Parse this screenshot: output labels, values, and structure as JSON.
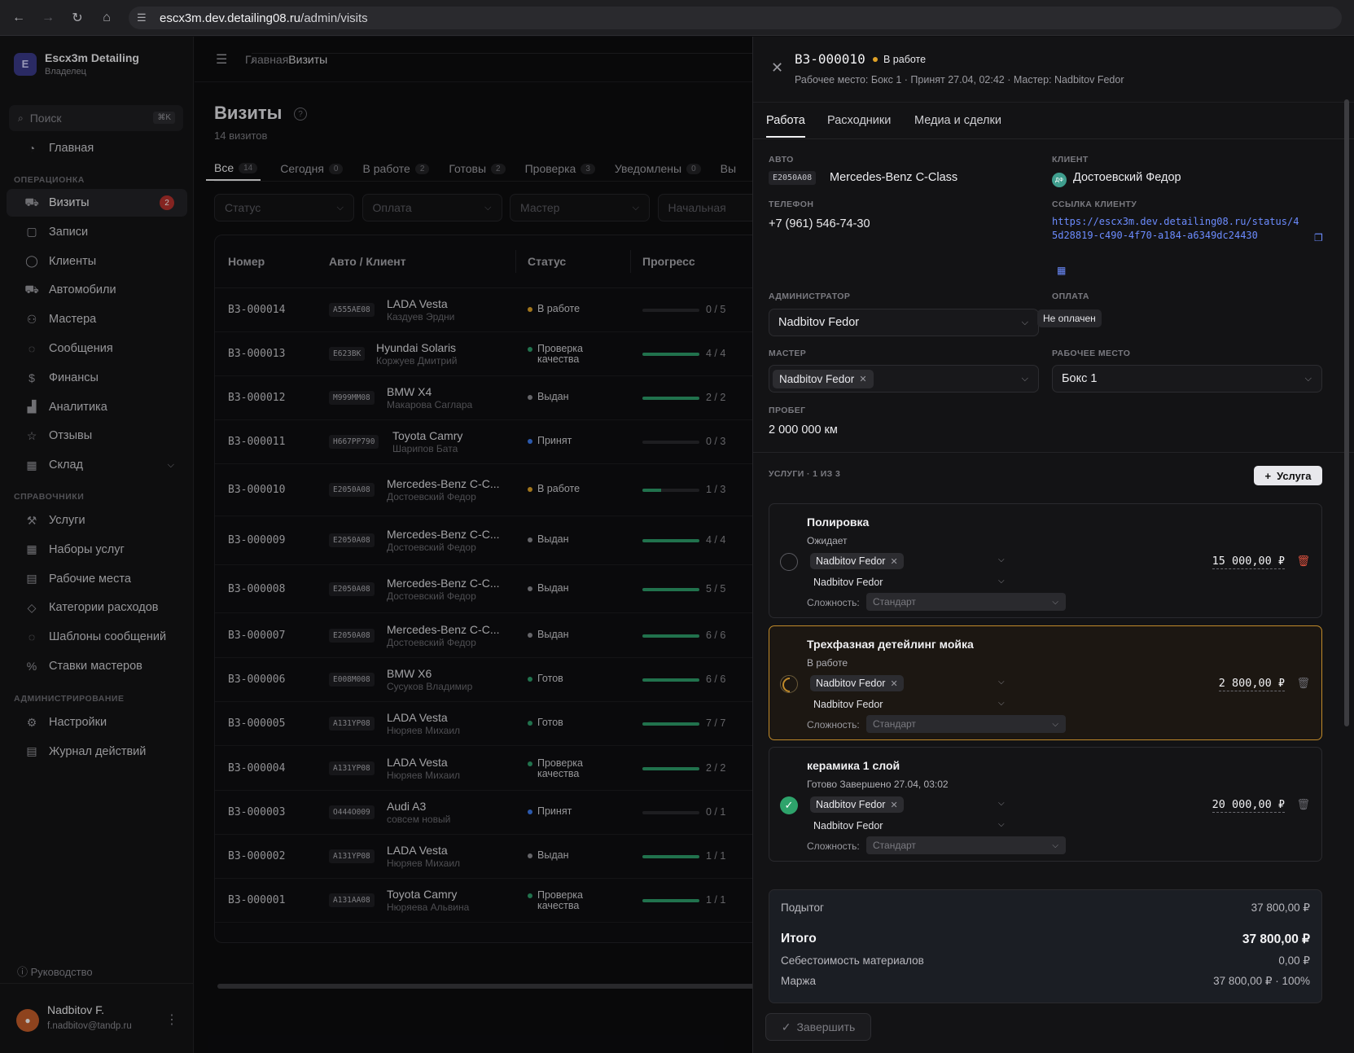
{
  "browser": {
    "url_host": "escx3m.dev.detailing08.ru",
    "url_path": "/admin/visits"
  },
  "sidebar": {
    "brand_initial": "E",
    "brand_name": "Escx3m Detailing",
    "brand_role": "Владелец",
    "search_placeholder": "Поиск",
    "search_shortcut": "⌘K",
    "home": "Главная",
    "sections": {
      "operations": "ОПЕРАЦИОНКА",
      "references": "СПРАВОЧНИКИ",
      "admin": "АДМИНИСТРИРОВАНИЕ"
    },
    "operations_items": [
      {
        "label": "Визиты",
        "icon": "car-icon",
        "badge": "2"
      },
      {
        "label": "Записи",
        "icon": "calendar-icon"
      },
      {
        "label": "Клиенты",
        "icon": "user-icon"
      },
      {
        "label": "Автомобили",
        "icon": "car-icon"
      },
      {
        "label": "Мастера",
        "icon": "users-icon"
      },
      {
        "label": "Сообщения",
        "icon": "message-icon"
      },
      {
        "label": "Финансы",
        "icon": "dollar-icon"
      },
      {
        "label": "Аналитика",
        "icon": "chart-icon"
      },
      {
        "label": "Отзывы",
        "icon": "star-icon"
      },
      {
        "label": "Склад",
        "icon": "grid-icon"
      }
    ],
    "reference_items": [
      {
        "label": "Услуги",
        "icon": "wrench-icon"
      },
      {
        "label": "Наборы услуг",
        "icon": "grid-icon"
      },
      {
        "label": "Рабочие места",
        "icon": "workplace-icon"
      },
      {
        "label": "Категории расходов",
        "icon": "tag-icon"
      },
      {
        "label": "Шаблоны сообщений",
        "icon": "message-icon"
      },
      {
        "label": "Ставки мастеров",
        "icon": "percent-icon"
      }
    ],
    "admin_items": [
      {
        "label": "Настройки",
        "icon": "gear-icon"
      },
      {
        "label": "Журнал действий",
        "icon": "log-icon"
      }
    ],
    "guide": "Руководство",
    "user_name": "Nadbitov F.",
    "user_email": "f.nadbitov@tandp.ru"
  },
  "main": {
    "breadcrumb_home": "Главная",
    "breadcrumb_current": "Визиты",
    "title": "Визиты",
    "subtitle": "14 визитов",
    "tabs": [
      {
        "label": "Все",
        "count": "14"
      },
      {
        "label": "Сегодня",
        "count": "0"
      },
      {
        "label": "В работе",
        "count": "2"
      },
      {
        "label": "Готовы",
        "count": "2"
      },
      {
        "label": "Проверка",
        "count": "3"
      },
      {
        "label": "Уведомлены",
        "count": "0"
      },
      {
        "label": "Вы",
        "count": ""
      }
    ],
    "filters": [
      "Статус",
      "Оплата",
      "Мастер",
      "Начальная"
    ],
    "columns": [
      "Номер",
      "Авто / Клиент",
      "Статус",
      "Прогресс"
    ],
    "rows": [
      {
        "num": "B3-000014",
        "plate": "A555AE08",
        "car": "LADA Vesta",
        "client": "Каздуев Эрдни",
        "status": "В работе",
        "status_color": "#e0a227",
        "progress": "0 / 5",
        "fill": 0.0
      },
      {
        "num": "B3-000013",
        "plate": "E623BK",
        "car": "Hyundai Solaris",
        "client": "Коржуев Дмитрий",
        "status": "Проверка качества",
        "status_color": "#2e9e6b",
        "progress": "4 / 4",
        "fill": 1.0
      },
      {
        "num": "B3-000012",
        "plate": "M999MM08",
        "car": "BMW X4",
        "client": "Макарова Саглара",
        "status": "Выдан",
        "status_color": "#8c8c92",
        "progress": "2 / 2",
        "fill": 1.0
      },
      {
        "num": "B3-000011",
        "plate": "H667PP790",
        "car": "Toyota Camry",
        "client": "Шарипов Бата",
        "status": "Принят",
        "status_color": "#3c7cf0",
        "progress": "0 / 3",
        "fill": 0.0
      },
      {
        "num": "B3-000010",
        "plate": "E2050A08",
        "car": "Mercedes-Benz C-C...",
        "client": "Достоевский Федор",
        "status": "В работе",
        "status_color": "#e0a227",
        "progress": "1 / 3",
        "fill": 0.33
      },
      {
        "num": "B3-000009",
        "plate": "E2050A08",
        "car": "Mercedes-Benz C-C...",
        "client": "Достоевский Федор",
        "status": "Выдан",
        "status_color": "#8c8c92",
        "progress": "4 / 4",
        "fill": 1.0
      },
      {
        "num": "B3-000008",
        "plate": "E2050A08",
        "car": "Mercedes-Benz C-C...",
        "client": "Достоевский Федор",
        "status": "Выдан",
        "status_color": "#8c8c92",
        "progress": "5 / 5",
        "fill": 1.0
      },
      {
        "num": "B3-000007",
        "plate": "E2050A08",
        "car": "Mercedes-Benz C-C...",
        "client": "Достоевский Федор",
        "status": "Выдан",
        "status_color": "#8c8c92",
        "progress": "6 / 6",
        "fill": 1.0
      },
      {
        "num": "B3-000006",
        "plate": "E008M008",
        "car": "BMW X6",
        "client": "Сусуков Владимир",
        "status": "Готов",
        "status_color": "#2e9e6b",
        "progress": "6 / 6",
        "fill": 1.0
      },
      {
        "num": "B3-000005",
        "plate": "A131YP08",
        "car": "LADA Vesta",
        "client": "Нюряев Михаил",
        "status": "Готов",
        "status_color": "#2e9e6b",
        "progress": "7 / 7",
        "fill": 1.0
      },
      {
        "num": "B3-000004",
        "plate": "A131YP08",
        "car": "LADA Vesta",
        "client": "Нюряев Михаил",
        "status": "Проверка качества",
        "status_color": "#2e9e6b",
        "progress": "2 / 2",
        "fill": 1.0
      },
      {
        "num": "B3-000003",
        "plate": "O444O009",
        "car": "Audi A3",
        "client": "совсем новый",
        "status": "Принят",
        "status_color": "#3c7cf0",
        "progress": "0 / 1",
        "fill": 0.0
      },
      {
        "num": "B3-000002",
        "plate": "A131YP08",
        "car": "LADA Vesta",
        "client": "Нюряев Михаил",
        "status": "Выдан",
        "status_color": "#8c8c92",
        "progress": "1 / 1",
        "fill": 1.0
      },
      {
        "num": "B3-000001",
        "plate": "A131AA08",
        "car": "Toyota Camry",
        "client": "Нюряева Альвина",
        "status": "Проверка качества",
        "status_color": "#2e9e6b",
        "progress": "1 / 1",
        "fill": 1.0
      }
    ]
  },
  "drawer": {
    "number": "B3-000010",
    "status": "В работе",
    "meta": "Рабочее место: Бокс 1 · Принят 27.04, 02:42 · Мастер: Nadbitov Fedor",
    "tabs": [
      "Работа",
      "Расходники",
      "Медиа и сделки"
    ],
    "labels": {
      "auto": "АВТО",
      "client": "КЛИЕНТ",
      "phone": "ТЕЛЕФОН",
      "client_link": "ССЫЛКА КЛИЕНТУ",
      "admin": "АДМИНИСТРАТОР",
      "payment": "ОПЛАТА",
      "master": "МАСТЕР",
      "workplace": "РАБОЧЕЕ МЕСТО",
      "mileage": "ПРОБЕГ",
      "services": "УСЛУГИ · 1 ИЗ 3"
    },
    "plate": "E2050A08",
    "car": "Mercedes-Benz C-Class",
    "client_initials": "ДФ",
    "client": "Достоевский Федор",
    "phone": "+7 (961) 546-74-30",
    "link": "https://escx3m.dev.detailing08.ru/status/45d28819-c490-4f70-a184-a6349dc24430",
    "admin": "Nadbitov Fedor",
    "payment": "Не оплачен",
    "master": "Nadbitov Fedor",
    "workplace": "Бокс 1",
    "mileage": "2 000 000 км",
    "add_service": "Услуга",
    "complexity_label": "Сложность:",
    "complexity_value": "Стандарт",
    "services": [
      {
        "title": "Полировка",
        "status": "Ожидает",
        "state": "pending",
        "master": "Nadbitov Fedor",
        "master2": "Nadbitov Fedor",
        "price": "15 000,00 ₽"
      },
      {
        "title": "Трехфазная детейлинг мойка",
        "status": "В работе",
        "state": "work",
        "master": "Nadbitov Fedor",
        "master2": "Nadbitov Fedor",
        "price": "2 800,00 ₽"
      },
      {
        "title": "керамика 1 слой",
        "status": "Готово   Завершено 27.04, 03:02",
        "state": "done",
        "master": "Nadbitov Fedor",
        "master2": "Nadbitov Fedor",
        "price": "20 000,00 ₽"
      }
    ],
    "totals": {
      "subtotal_label": "Подытог",
      "subtotal": "37 800,00 ₽",
      "total_label": "Итого",
      "total": "37 800,00 ₽",
      "cost_label": "Себестоимость материалов",
      "cost": "0,00 ₽",
      "margin_label": "Маржа",
      "margin": "37 800,00 ₽ · 100%"
    },
    "finish": "Завершить"
  },
  "colors": {
    "accent_work": "#e0a227",
    "accent_done": "#2e9e6b",
    "badge_red": "#b8322e",
    "link_blue": "#6c8cff"
  }
}
